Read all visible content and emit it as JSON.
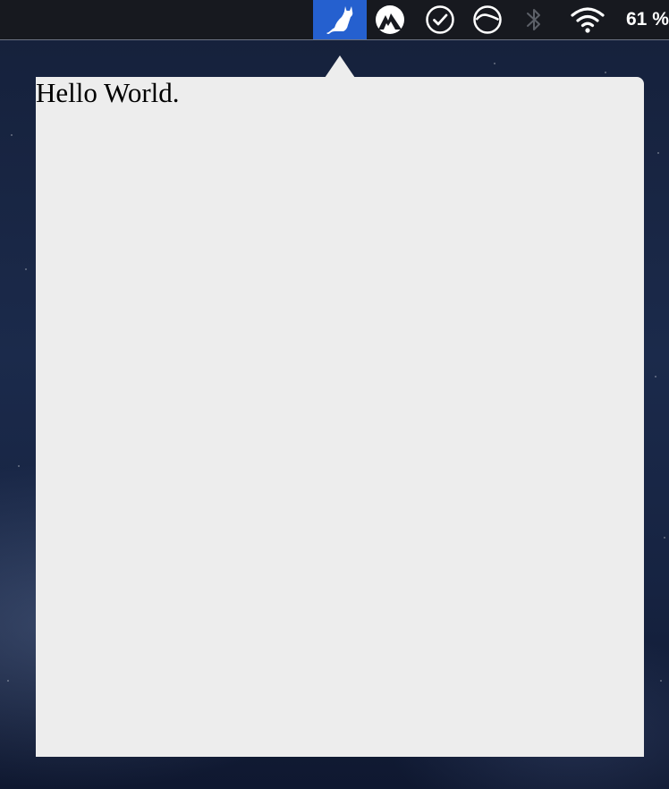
{
  "menubar": {
    "items": [
      {
        "icon": "cat-icon",
        "active": true
      },
      {
        "icon": "nordvpn-icon",
        "active": false
      },
      {
        "icon": "checkmark-circle-icon",
        "active": false
      },
      {
        "icon": "sync-circle-icon",
        "active": false
      },
      {
        "icon": "bluetooth-icon",
        "active": false
      },
      {
        "icon": "wifi-icon",
        "active": false
      }
    ],
    "battery_percent": "61 %"
  },
  "popover": {
    "text": "Hello World."
  },
  "colors": {
    "menubar_bg": "#17191f",
    "active_item_bg": "#2560cf",
    "popover_bg": "#ededed",
    "desktop_bg": "#1b2a4b"
  }
}
